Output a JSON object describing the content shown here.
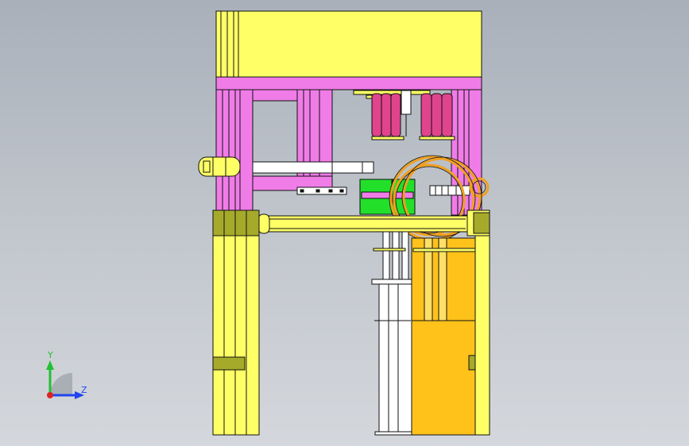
{
  "viewport": {
    "background_top": "#a9b0ba",
    "background_bottom": "#d4d7dc"
  },
  "model": {
    "colors": {
      "frame_pink": "#f07ce8",
      "magenta_clamp": "#e0448c",
      "yellow_body": "#ffff66",
      "olive_collar": "#a6aa2a",
      "green_block": "#22e02a",
      "orange_base": "#ffc21a",
      "gold_ring": "#f0a020",
      "white_part": "#ffffff",
      "edge": "#111111"
    }
  },
  "triad": {
    "y_label": "Y",
    "z_label": "Z",
    "y_color": "#22c033",
    "z_color": "#2244ee",
    "x_color": "#dd2222"
  }
}
